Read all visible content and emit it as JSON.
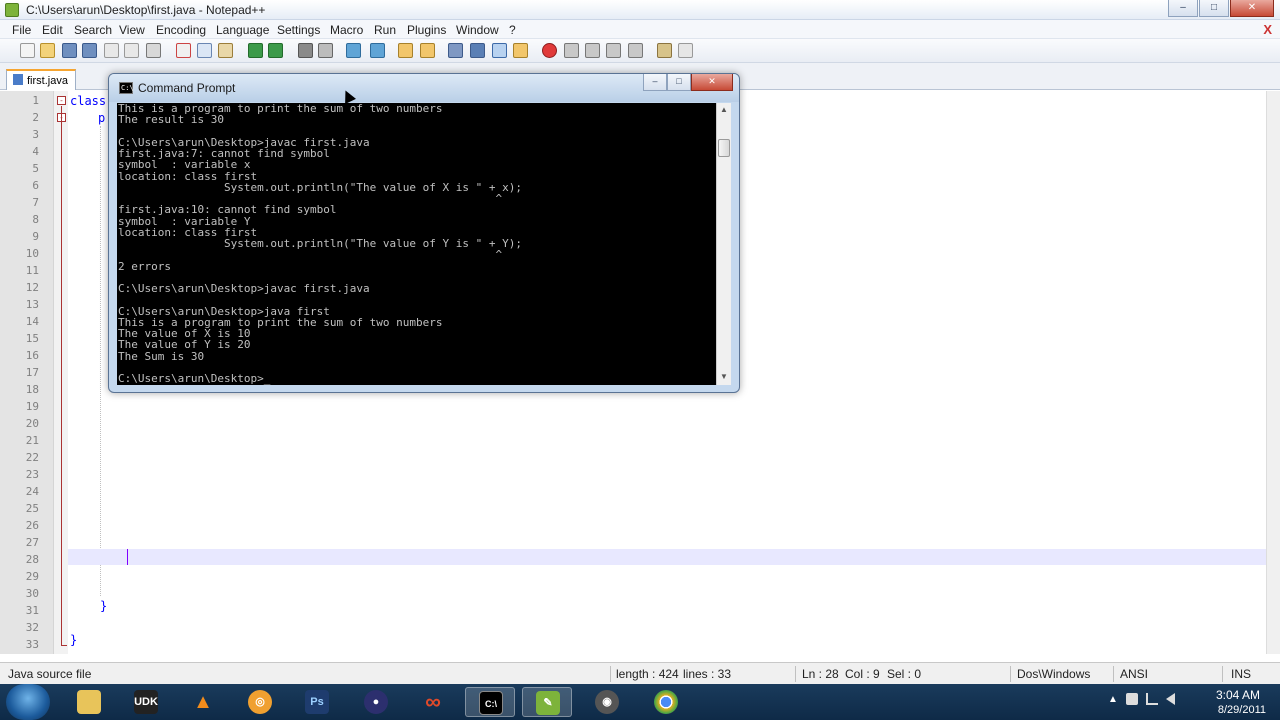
{
  "window": {
    "title": "C:\\Users\\arun\\Desktop\\first.java - Notepad++",
    "controls": [
      "–",
      "□",
      "✕"
    ]
  },
  "menu": [
    "File",
    "Edit",
    "Search",
    "View",
    "Encoding",
    "Language",
    "Settings",
    "Macro",
    "Run",
    "Plugins",
    "Window",
    "?"
  ],
  "menu_close": "X",
  "tabs": [
    {
      "label": "first.java"
    }
  ],
  "editor": {
    "line_numbers": [
      "1",
      "2",
      "3",
      "4",
      "5",
      "6",
      "7",
      "8",
      "9",
      "10",
      "11",
      "12",
      "13",
      "14",
      "15",
      "16",
      "17",
      "18",
      "19",
      "20",
      "21",
      "22",
      "23",
      "24",
      "25",
      "26",
      "27",
      "28",
      "29",
      "30",
      "31",
      "32",
      "33"
    ],
    "visible_code": {
      "line1": "class",
      "line2": "p",
      "line31": "}",
      "line33": "}"
    },
    "fold_markers": [
      "-",
      "-"
    ]
  },
  "cmd": {
    "title": "Command Prompt",
    "icon_text": "C:\\",
    "controls": [
      "–",
      "□",
      "✕"
    ],
    "lines": [
      "This is a program to print the sum of two numbers",
      "The result is 30",
      "",
      "C:\\Users\\arun\\Desktop>javac first.java",
      "first.java:7: cannot find symbol",
      "symbol  : variable x",
      "location: class first",
      "                System.out.println(\"The value of X is \" + x);",
      "                                                         ^",
      "first.java:10: cannot find symbol",
      "symbol  : variable Y",
      "location: class first",
      "                System.out.println(\"The value of Y is \" + Y);",
      "                                                         ^",
      "2 errors",
      "",
      "C:\\Users\\arun\\Desktop>javac first.java",
      "",
      "C:\\Users\\arun\\Desktop>java first",
      "This is a program to print the sum of two numbers",
      "The value of X is 10",
      "The value of Y is 20",
      "The Sum is 30",
      "",
      "C:\\Users\\arun\\Desktop>_"
    ]
  },
  "status": {
    "file_type": "Java source file",
    "length": "length : 424",
    "lines": "lines : 33",
    "ln": "Ln : 28",
    "col": "Col : 9",
    "sel": "Sel : 0",
    "eol": "Dos\\Windows",
    "encoding": "ANSI",
    "mode": "INS"
  },
  "taskbar": {
    "apps": [
      {
        "name": "windows-explorer",
        "glyph": "",
        "color": "#e8c45a"
      },
      {
        "name": "udk",
        "glyph": "UDK",
        "color": "#222222"
      },
      {
        "name": "vlc",
        "glyph": "▲",
        "color": "#f28c1c"
      },
      {
        "name": "app-circle",
        "glyph": "◎",
        "color": "#f0a030"
      },
      {
        "name": "photoshop",
        "glyph": "Ps",
        "color": "#1e3c6e"
      },
      {
        "name": "eclipse",
        "glyph": "●",
        "color": "#2c2f6e"
      },
      {
        "name": "infinity-app",
        "glyph": "∞",
        "color": "#d23c2c"
      },
      {
        "name": "command-prompt",
        "glyph": "C:\\",
        "color": "#000000"
      },
      {
        "name": "notepad-plus-plus",
        "glyph": "✎",
        "color": "#7db33b"
      },
      {
        "name": "cd-app",
        "glyph": "◉",
        "color": "#555555"
      },
      {
        "name": "chrome",
        "glyph": "◉",
        "color": "#d9372b"
      }
    ],
    "clock_time": "3:04 AM",
    "clock_date": "8/29/2011"
  }
}
